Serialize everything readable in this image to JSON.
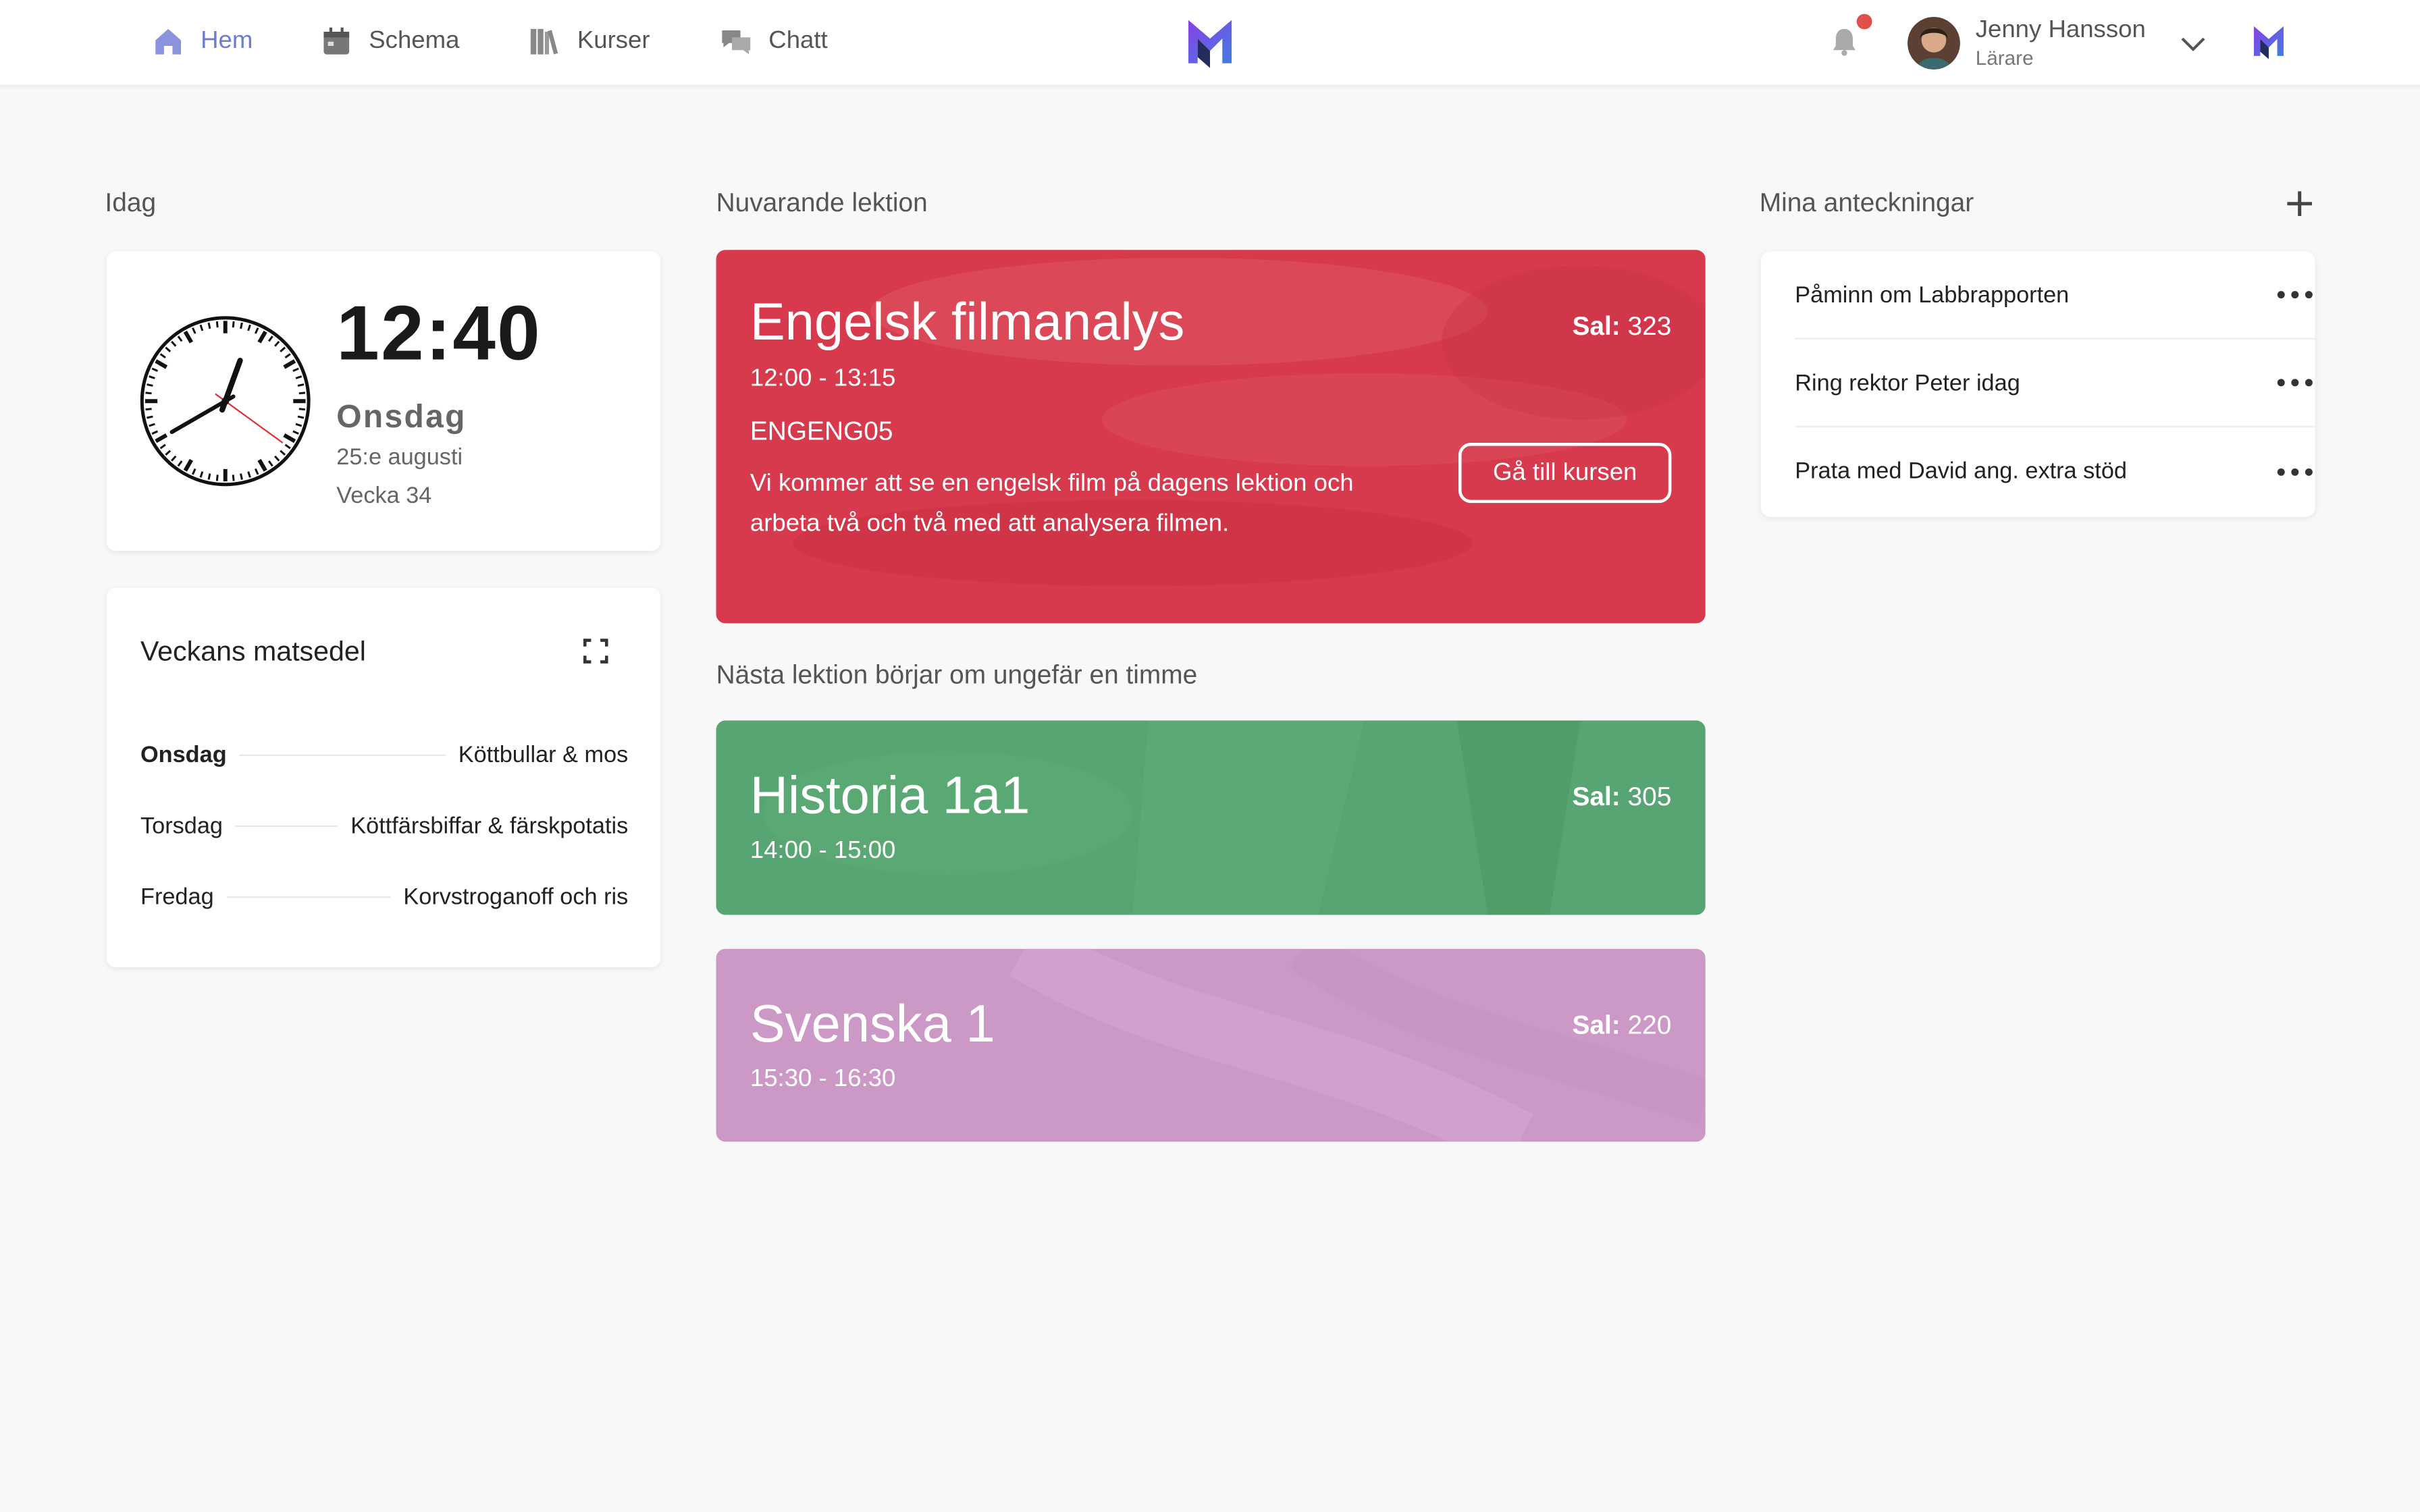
{
  "nav": {
    "items": [
      {
        "label": "Hem",
        "icon": "home-icon"
      },
      {
        "label": "Schema",
        "icon": "calendar-icon"
      },
      {
        "label": "Kurser",
        "icon": "books-icon"
      },
      {
        "label": "Chatt",
        "icon": "chat-icon"
      }
    ]
  },
  "user": {
    "name": "Jenny Hansson",
    "role": "Lärare"
  },
  "today": {
    "section_title": "Idag",
    "time": "12:40",
    "day": "Onsdag",
    "date": "25:e augusti",
    "week": "Vecka 34"
  },
  "menu": {
    "title": "Veckans matsedel",
    "rows": [
      {
        "day": "Onsdag",
        "meal": "Köttbullar & mos"
      },
      {
        "day": "Torsdag",
        "meal": "Köttfärsbiffar & färskpotatis"
      },
      {
        "day": "Fredag",
        "meal": "Korvstroganoff och ris"
      }
    ]
  },
  "current": {
    "section_title": "Nuvarande lektion",
    "title": "Engelsk filmanalys",
    "time": "12:00 - 13:15",
    "room_label": "Sal:",
    "room": "323",
    "code": "ENGENG05",
    "description": "Vi kommer att se en engelsk film på dagens lektion och arbeta två och två med att analysera filmen.",
    "button": "Gå till kursen",
    "color": "#d63a4c"
  },
  "next": {
    "section_title": "Nästa lektion börjar om ungefär en timme",
    "lessons": [
      {
        "title": "Historia 1a1",
        "time": "14:00 - 15:00",
        "room_label": "Sal:",
        "room": "305",
        "color": "#57a572"
      },
      {
        "title": "Svenska 1",
        "time": "15:30 - 16:30",
        "room_label": "Sal:",
        "room": "220",
        "color": "#cc99c6"
      }
    ]
  },
  "notes": {
    "section_title": "Mina anteckningar",
    "items": [
      {
        "text": "Påminn om Labbrapporten"
      },
      {
        "text": "Ring rektor Peter idag"
      },
      {
        "text": "Prata med David ang. extra stöd"
      }
    ]
  },
  "colors": {
    "accent": "#6e7bd0",
    "notification": "#e0504a",
    "logo_purple": "#7b3fe0",
    "logo_blue": "#3f8de0"
  }
}
